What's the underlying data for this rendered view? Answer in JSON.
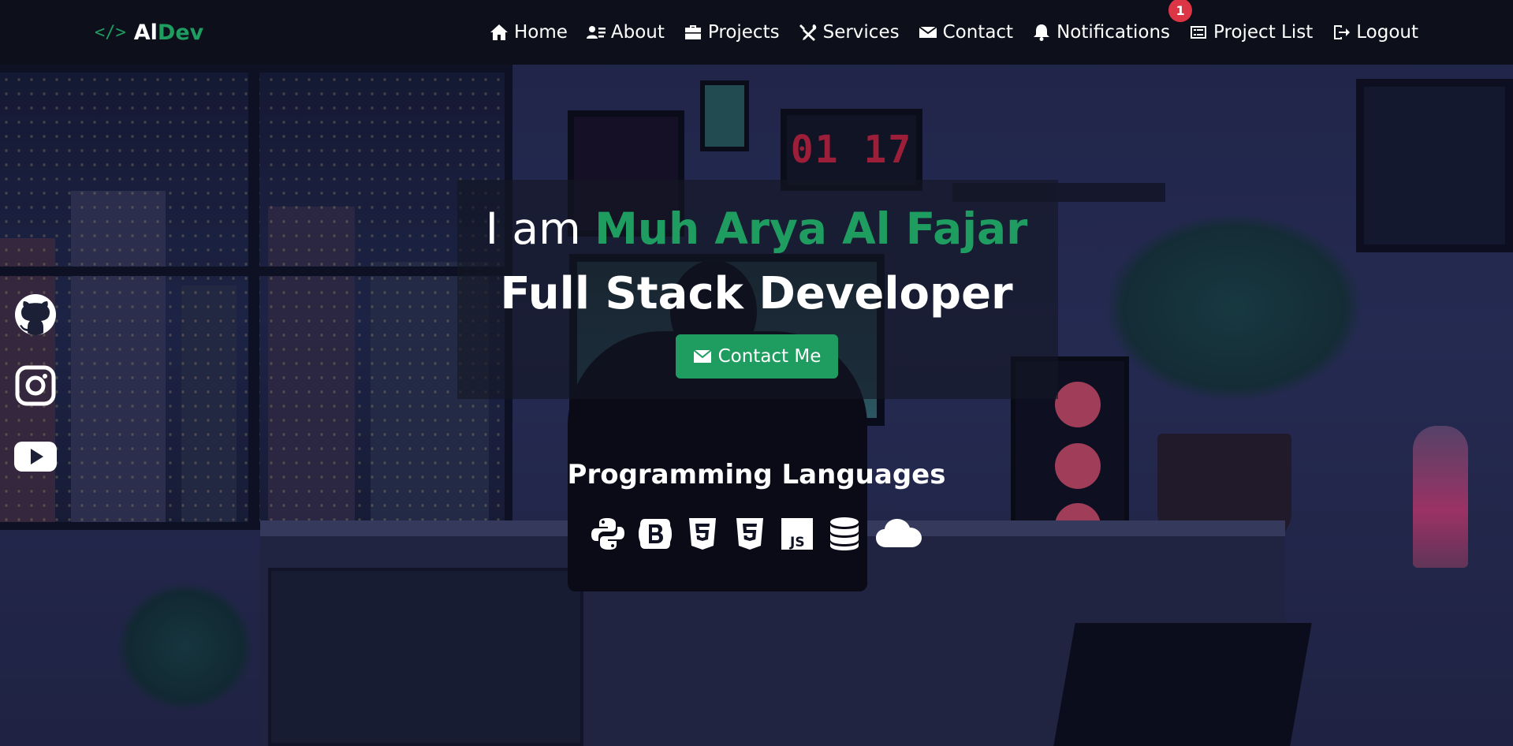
{
  "brand": {
    "icon": "code-icon",
    "icon_glyph": "</>",
    "name_part1": "Al",
    "name_part2": "Dev"
  },
  "nav": {
    "items": [
      {
        "label": "Home",
        "icon": "home-icon"
      },
      {
        "label": "About",
        "icon": "user-card-icon"
      },
      {
        "label": "Projects",
        "icon": "briefcase-icon"
      },
      {
        "label": "Services",
        "icon": "tools-icon"
      },
      {
        "label": "Contact",
        "icon": "envelope-icon"
      },
      {
        "label": "Notifications",
        "icon": "bell-icon",
        "badge": "1"
      },
      {
        "label": "Project List",
        "icon": "list-icon"
      },
      {
        "label": "Logout",
        "icon": "logout-icon"
      }
    ]
  },
  "hero": {
    "prefix": "I am",
    "name": "Muh Arya Al Fajar",
    "role": "Full Stack Developer",
    "cta_label": "Contact Me"
  },
  "languages": {
    "title": "Programming Languages",
    "icons": [
      "python-icon",
      "bootstrap-icon",
      "html5-icon",
      "css3-icon",
      "javascript-icon",
      "database-icon",
      "cloud-icon"
    ]
  },
  "social": {
    "icons": [
      "github-icon",
      "instagram-icon",
      "youtube-icon"
    ]
  },
  "scene": {
    "clock_display": "01 17"
  },
  "colors": {
    "accent": "#1f9d60",
    "badge": "#dc3545",
    "navbar": "#0c0e18"
  }
}
